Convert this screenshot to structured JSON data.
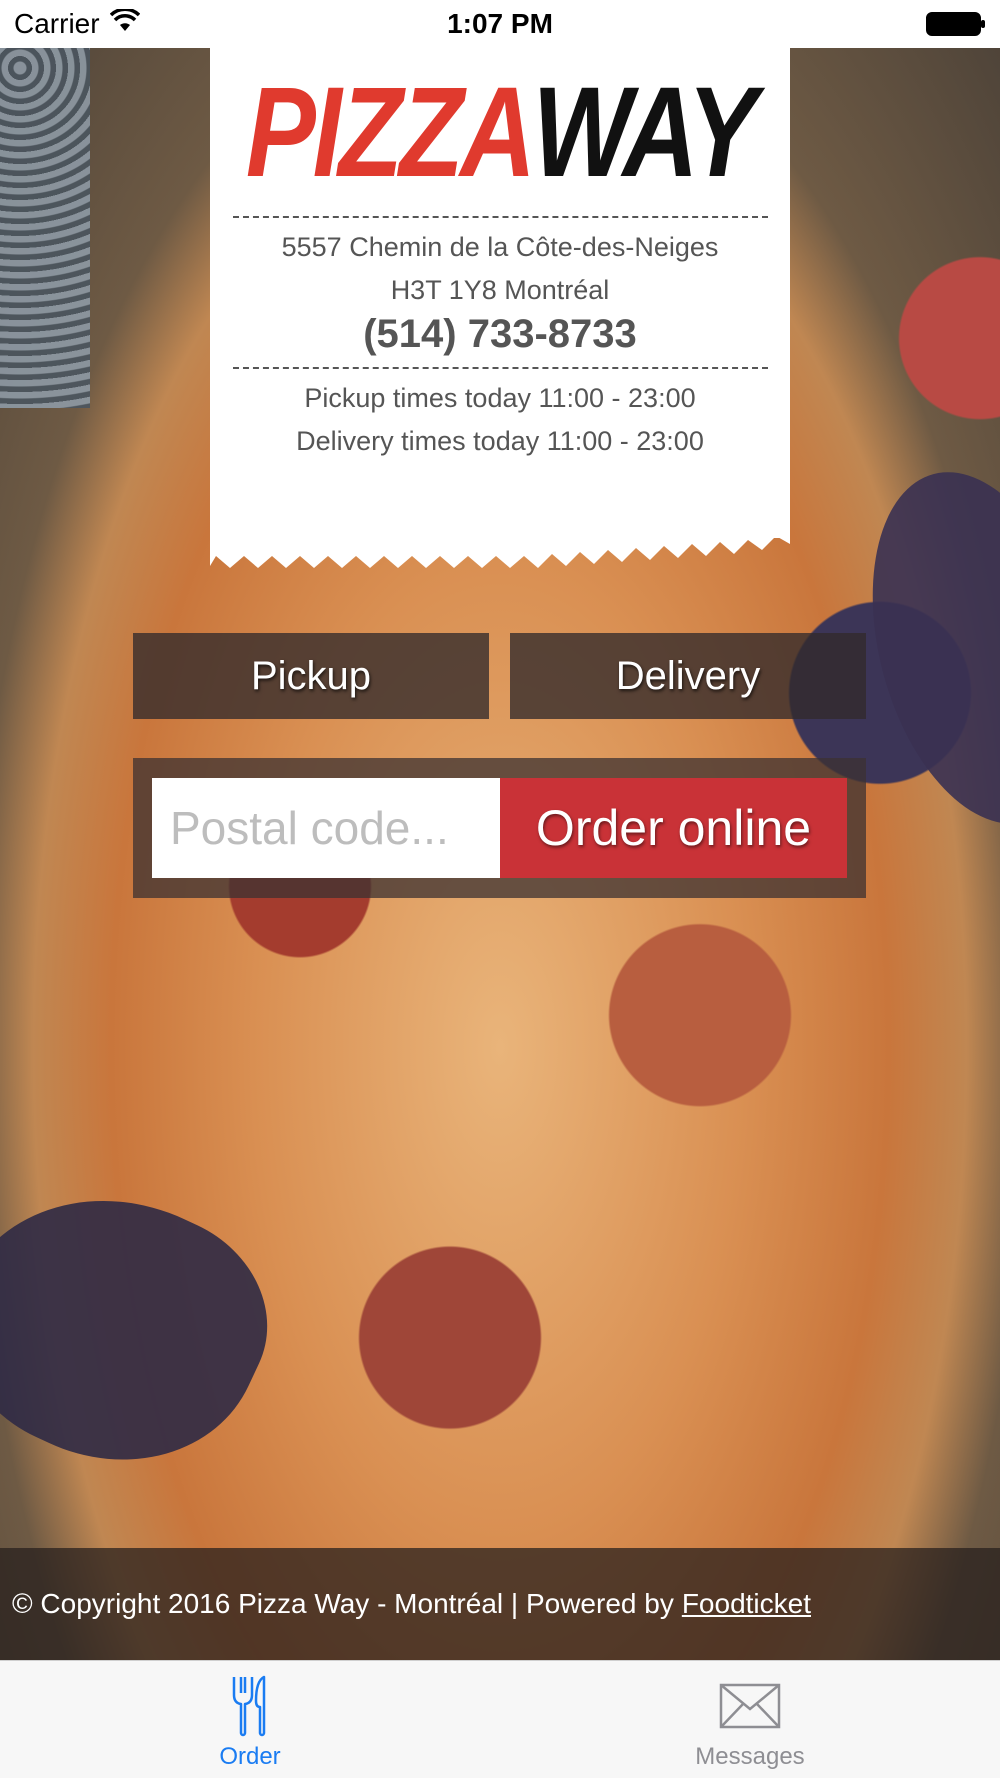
{
  "status_bar": {
    "carrier": "Carrier",
    "time": "1:07 PM"
  },
  "logo": {
    "part1": "PIZZA",
    "part2": "WAY",
    "color_part1": "#e03a2e",
    "color_part2": "#111111"
  },
  "info": {
    "address_line1": "5557 Chemin de la Côte-des-Neiges",
    "address_line2": "H3T 1Y8 Montréal",
    "phone": "(514) 733-8733",
    "pickup_times": "Pickup times today 11:00 - 23:00",
    "delivery_times": "Delivery times today 11:00 - 23:00"
  },
  "mode": {
    "pickup_label": "Pickup",
    "delivery_label": "Delivery"
  },
  "order": {
    "postal_placeholder": "Postal code...",
    "order_button": "Order online",
    "accent": "#c93237"
  },
  "footer": {
    "text": "© Copyright 2016 Pizza Way - Montréal | Powered by",
    "link": "Foodticket"
  },
  "tabs": [
    {
      "label": "Order",
      "icon": "fork-knife-icon",
      "active": true,
      "color": "#1a7cf2"
    },
    {
      "label": "Messages",
      "icon": "envelope-icon",
      "active": false,
      "color": "#8e8e93"
    }
  ]
}
